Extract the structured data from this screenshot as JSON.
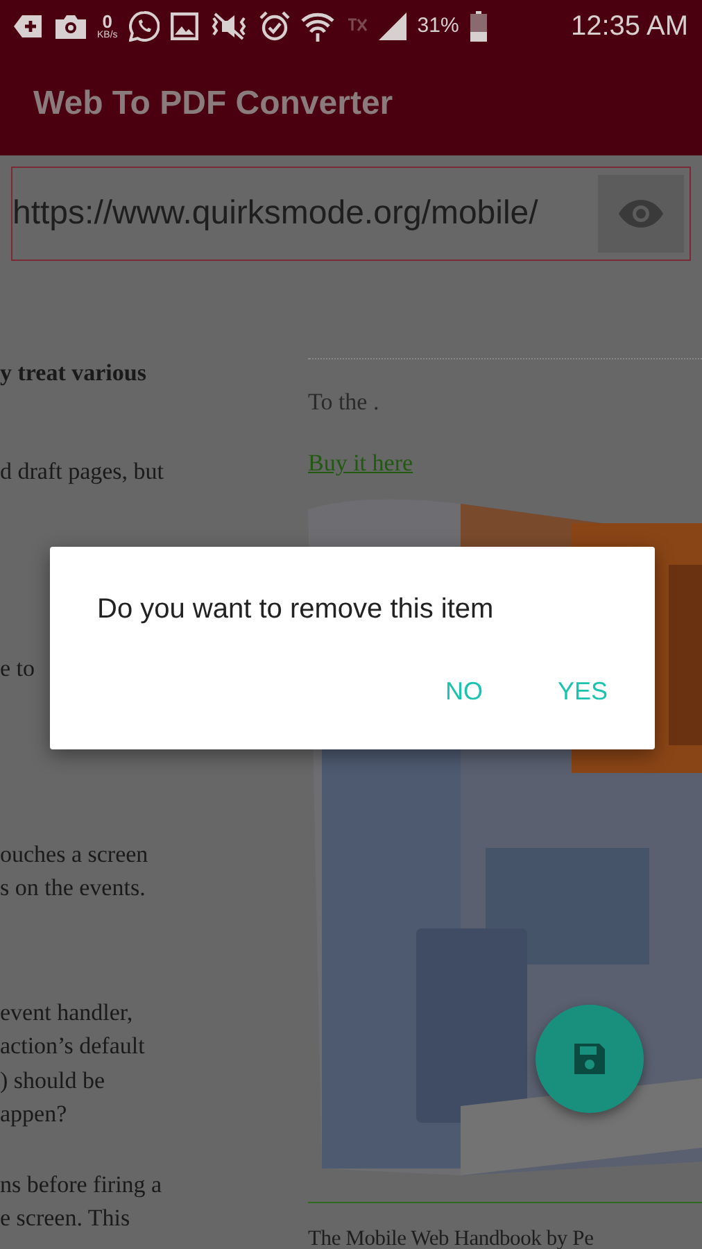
{
  "status_bar": {
    "network_speed": "0",
    "speed_unit": "KB/s",
    "battery": "31%",
    "time": "12:35 AM"
  },
  "app_bar": {
    "title": "Web To PDF Converter"
  },
  "url_field": {
    "value": "https://www.quirksmode.org/mobile/"
  },
  "page": {
    "left_paragraphs": [
      {
        "bold": true,
        "lines": [
          "y treat various"
        ]
      },
      {
        "bold": false,
        "lines": [
          "d draft pages, but"
        ]
      },
      {
        "bold": false,
        "lines": [
          "e to"
        ]
      },
      {
        "bold": false,
        "lines": [
          "ouches a screen",
          "s on the events."
        ]
      },
      {
        "bold": false,
        "lines": [
          "event handler,",
          "action’s default",
          ") should be",
          "appen?"
        ]
      },
      {
        "bold": false,
        "lines": [
          "ns before firing a",
          "e screen. This"
        ]
      }
    ],
    "intro": "To the .",
    "link": "Buy it here",
    "caption": "The Mobile Web Handbook by Pe"
  },
  "dialog": {
    "message": "Do you want to remove this item",
    "buttons": [
      "NO",
      "YES"
    ]
  }
}
